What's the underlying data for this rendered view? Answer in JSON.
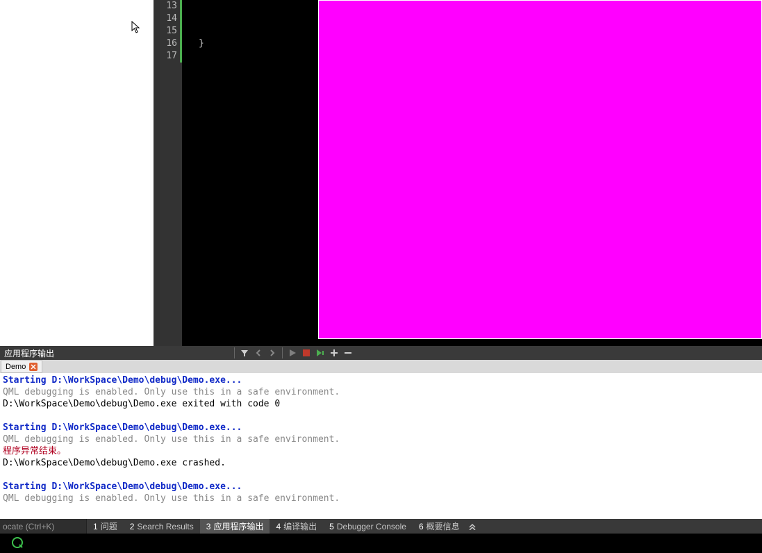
{
  "editor": {
    "line_numbers": [
      13,
      14,
      15,
      16,
      17
    ],
    "lines": {
      "13": "",
      "14": "",
      "15": "",
      "16": "}",
      "17": ""
    }
  },
  "preview": {
    "color": "#ff00ff"
  },
  "output_toolbar": {
    "title": "应用程序输出"
  },
  "output_tab": {
    "label": "Demo"
  },
  "output": {
    "lines": [
      {
        "cls": "c-blue",
        "t": "Starting D:\\WorkSpace\\Demo\\debug\\Demo.exe..."
      },
      {
        "cls": "c-gray",
        "t": "QML debugging is enabled. Only use this in a safe environment."
      },
      {
        "cls": "c-black",
        "t": "D:\\WorkSpace\\Demo\\debug\\Demo.exe exited with code 0"
      },
      {
        "cls": "",
        "t": " "
      },
      {
        "cls": "c-blue",
        "t": "Starting D:\\WorkSpace\\Demo\\debug\\Demo.exe..."
      },
      {
        "cls": "c-gray",
        "t": "QML debugging is enabled. Only use this in a safe environment."
      },
      {
        "cls": "c-red",
        "t": "程序异常结束。"
      },
      {
        "cls": "c-black",
        "t": "D:\\WorkSpace\\Demo\\debug\\Demo.exe crashed."
      },
      {
        "cls": "",
        "t": " "
      },
      {
        "cls": "c-blue",
        "t": "Starting D:\\WorkSpace\\Demo\\debug\\Demo.exe..."
      },
      {
        "cls": "c-gray",
        "t": "QML debugging is enabled. Only use this in a safe environment."
      }
    ]
  },
  "locator": {
    "placeholder": "ocate (Ctrl+K)"
  },
  "bottom_tabs": [
    {
      "num": "1",
      "label": "问题"
    },
    {
      "num": "2",
      "label": "Search Results"
    },
    {
      "num": "3",
      "label": "应用程序输出"
    },
    {
      "num": "4",
      "label": "编译输出"
    },
    {
      "num": "5",
      "label": "Debugger Console"
    },
    {
      "num": "6",
      "label": "概要信息"
    }
  ]
}
